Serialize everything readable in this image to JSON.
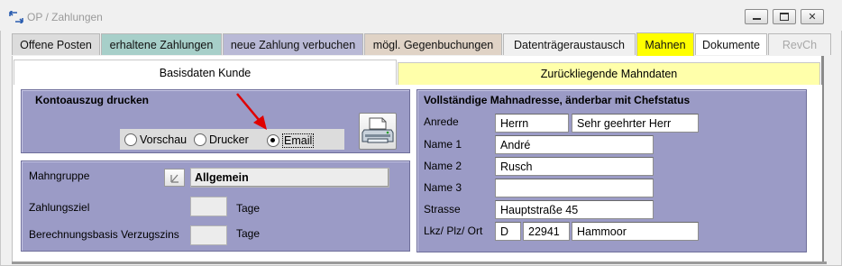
{
  "window": {
    "title": "OP / Zahlungen",
    "controls": {
      "minimize": "▭",
      "maximize": "□",
      "close": "✕"
    }
  },
  "tabs": [
    {
      "label": "Offene Posten",
      "color": "#dcdcdc"
    },
    {
      "label": "erhaltene Zahlungen",
      "color": "#a7cfc9"
    },
    {
      "label": "neue Zahlung verbuchen",
      "color": "#b9b9d6"
    },
    {
      "label": "mögl. Gegenbuchungen",
      "color": "#e0d3c6"
    },
    {
      "label": "Datenträgeraustausch",
      "color": "#f0f0f0"
    },
    {
      "label": "Mahnen",
      "color": "#ffff00",
      "active": true
    },
    {
      "label": "Dokumente",
      "color": "#ffffff"
    },
    {
      "label": "RevCh",
      "color": "#f0f0f0",
      "disabled": true
    }
  ],
  "subtabs": [
    {
      "label": "Basisdaten Kunde",
      "active": true
    },
    {
      "label": "Zurückliegende Mahndaten",
      "color": "#ffffaa"
    }
  ],
  "kontoauszug": {
    "title": "Kontoauszug drucken",
    "options": [
      {
        "label": "Vorschau",
        "selected": false
      },
      {
        "label": "Drucker",
        "selected": false
      },
      {
        "label": "Email",
        "selected": true
      }
    ],
    "print_icon": "printer-icon"
  },
  "mahn": {
    "gruppe_label": "Mahngruppe",
    "gruppe_value": "Allgemein",
    "zahlungsziel_label": "Zahlungsziel",
    "zahlungsziel_value": "",
    "zahlungsziel_unit": "Tage",
    "verzugszins_label": "Berechnungsbasis Verzugszins",
    "verzugszins_value": "",
    "verzugszins_unit": "Tage"
  },
  "adresse": {
    "title": "Vollständige Mahnadresse, änderbar mit Chefstatus",
    "anrede_label": "Anrede",
    "anrede": "Herrn",
    "briefanrede": "Sehr geehrter Herr",
    "name1_label": "Name 1",
    "name1": "André",
    "name2_label": "Name 2",
    "name2": "Rusch",
    "name3_label": "Name 3",
    "name3": "",
    "strasse_label": "Strasse",
    "strasse": "Hauptstraße 45",
    "ort_label": "Lkz/ Plz/ Ort",
    "lkz": "D",
    "plz": "22941",
    "ort": "Hammoor"
  },
  "colors": {
    "panel": "#9b9bc6",
    "active_tab": "#ffff00",
    "arrow": "#e00000"
  }
}
